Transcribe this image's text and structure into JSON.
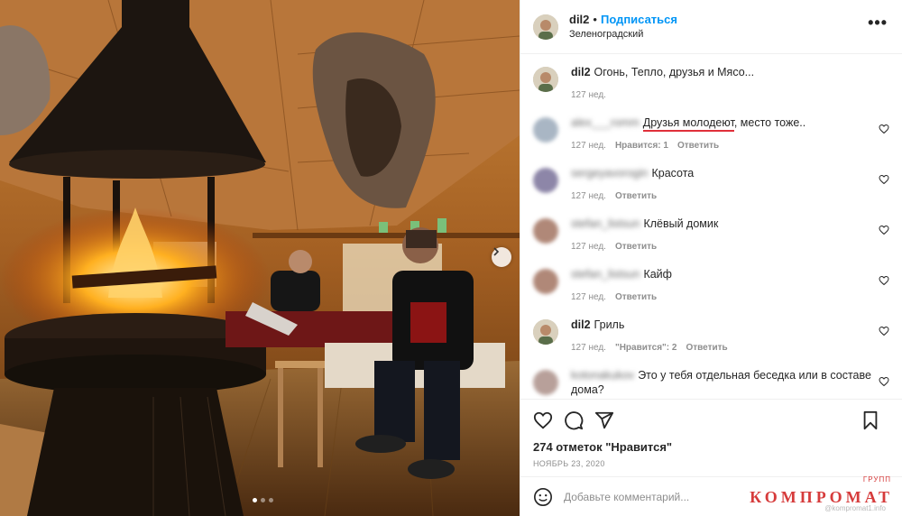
{
  "post": {
    "username": "dil2",
    "separator": "•",
    "follow_label": "Подписаться",
    "location": "Зеленоградский",
    "more_label": "•••"
  },
  "comments": [
    {
      "user": "dil2",
      "text": "Огонь, Тепло, друзья и Мясо...",
      "time": "127 нед.",
      "likes": "",
      "reply": "",
      "blurred": false,
      "heart": false
    },
    {
      "user": "alex___romm",
      "text_highlight": "Друзья молодеют",
      "text": ", место тоже..",
      "time": "127 нед.",
      "likes": "Нравится: 1",
      "reply": "Ответить",
      "blurred": true,
      "heart": true
    },
    {
      "user": "sergeyavorogin",
      "text": "Красота",
      "time": "127 нед.",
      "likes": "",
      "reply": "Ответить",
      "blurred": true,
      "heart": true
    },
    {
      "user": "stefan_listsun",
      "text": "Клёвый домик",
      "time": "127 нед.",
      "likes": "",
      "reply": "Ответить",
      "blurred": true,
      "heart": true
    },
    {
      "user": "stefan_listsun",
      "text": "Кайф",
      "time": "127 нед.",
      "likes": "",
      "reply": "Ответить",
      "blurred": true,
      "heart": true
    },
    {
      "user": "dil2",
      "text": "Гриль",
      "time": "127 нед.",
      "likes": "\"Нравится\": 2",
      "reply": "Ответить",
      "blurred": false,
      "heart": true
    },
    {
      "user": "kotonakukov",
      "text": "Это у тебя отдельная беседка или в составе дома?",
      "time": "",
      "likes": "",
      "reply": "",
      "blurred": true,
      "heart": true
    }
  ],
  "actions": {
    "like_icon": "heart-icon",
    "comment_icon": "comment-icon",
    "share_icon": "paper-plane-icon",
    "save_icon": "bookmark-icon"
  },
  "likes_text": "274 отметок \"Нравится\"",
  "date_text": "НОЯБРЬ 23, 2020",
  "add_comment": {
    "placeholder": "Добавьте комментарий...",
    "emoji_icon": "smile-icon"
  },
  "watermark": {
    "main": "КОМПРОМАТ",
    "small": "ГРУПП",
    "url": "@kompromat1.info"
  },
  "carousel": {
    "count": 3,
    "active": 0
  },
  "colors": {
    "accent": "#0095f6",
    "watermark": "#d63b3b",
    "highlight": "#e0303a"
  }
}
